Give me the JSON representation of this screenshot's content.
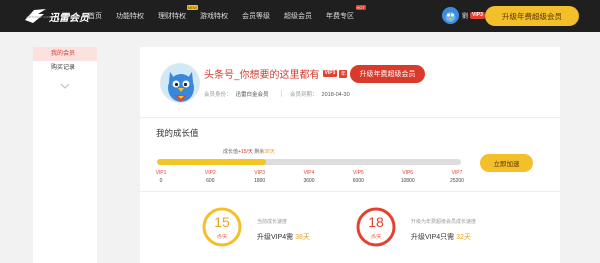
{
  "header": {
    "logo_text": "迅雷会员",
    "logo_sub": "VIP.XUNLEI.COM",
    "nav": [
      {
        "label": "首页",
        "tag": ""
      },
      {
        "label": "功能特权",
        "tag": ""
      },
      {
        "label": "理财特权",
        "tag": "NEW"
      },
      {
        "label": "游戏特权",
        "tag": ""
      },
      {
        "label": "会员等级",
        "tag": ""
      },
      {
        "label": "超级会员",
        "tag": ""
      },
      {
        "label": "年费专区",
        "tag": "HOT"
      }
    ],
    "user_short": "劉",
    "vip_badge": "VIP3",
    "upgrade_button": "升级年费超级会员"
  },
  "sidebar": {
    "items": [
      {
        "label": "我的会员",
        "active": true
      },
      {
        "label": "购买记录",
        "active": false
      }
    ]
  },
  "profile": {
    "username": "头条号_你想要的这里都有",
    "vip_badge": "VIP3",
    "year_badge": "年",
    "identity_label": "会员身份：",
    "identity_value": "迅雷白金会员",
    "expire_label": "会员到期：",
    "expire_value": "2018-04-30",
    "upgrade_button": "升级年费超级会员"
  },
  "growth": {
    "title": "我的成长值",
    "today_prefix": "成长值+",
    "today_value": "15",
    "today_unit": "/天",
    "remain_prefix": " 剩余",
    "remain_value": "38",
    "remain_unit": "天",
    "progress_fraction": 0.36,
    "speed_button": "立即加速",
    "levels": [
      {
        "name": "VIP1",
        "value": "0"
      },
      {
        "name": "VIP2",
        "value": "600"
      },
      {
        "name": "VIP3",
        "value": "1800"
      },
      {
        "name": "VIP4",
        "value": "3600"
      },
      {
        "name": "VIP5",
        "value": "6000"
      },
      {
        "name": "VIP6",
        "value": "10800"
      },
      {
        "name": "VIP7",
        "value": "25200"
      }
    ]
  },
  "cards": [
    {
      "ring_value": "15",
      "ring_unit": "点/天",
      "label": "当前成长速度",
      "text_prefix": "升级VIP4需 ",
      "text_highlight": "38天",
      "color": "#f3bf2a"
    },
    {
      "ring_value": "18",
      "ring_unit": "点/天",
      "label": "升级为年费超级会员成长速度",
      "text_prefix": "升级VIP4只需 ",
      "text_highlight": "32天",
      "color": "#e5412f"
    }
  ]
}
